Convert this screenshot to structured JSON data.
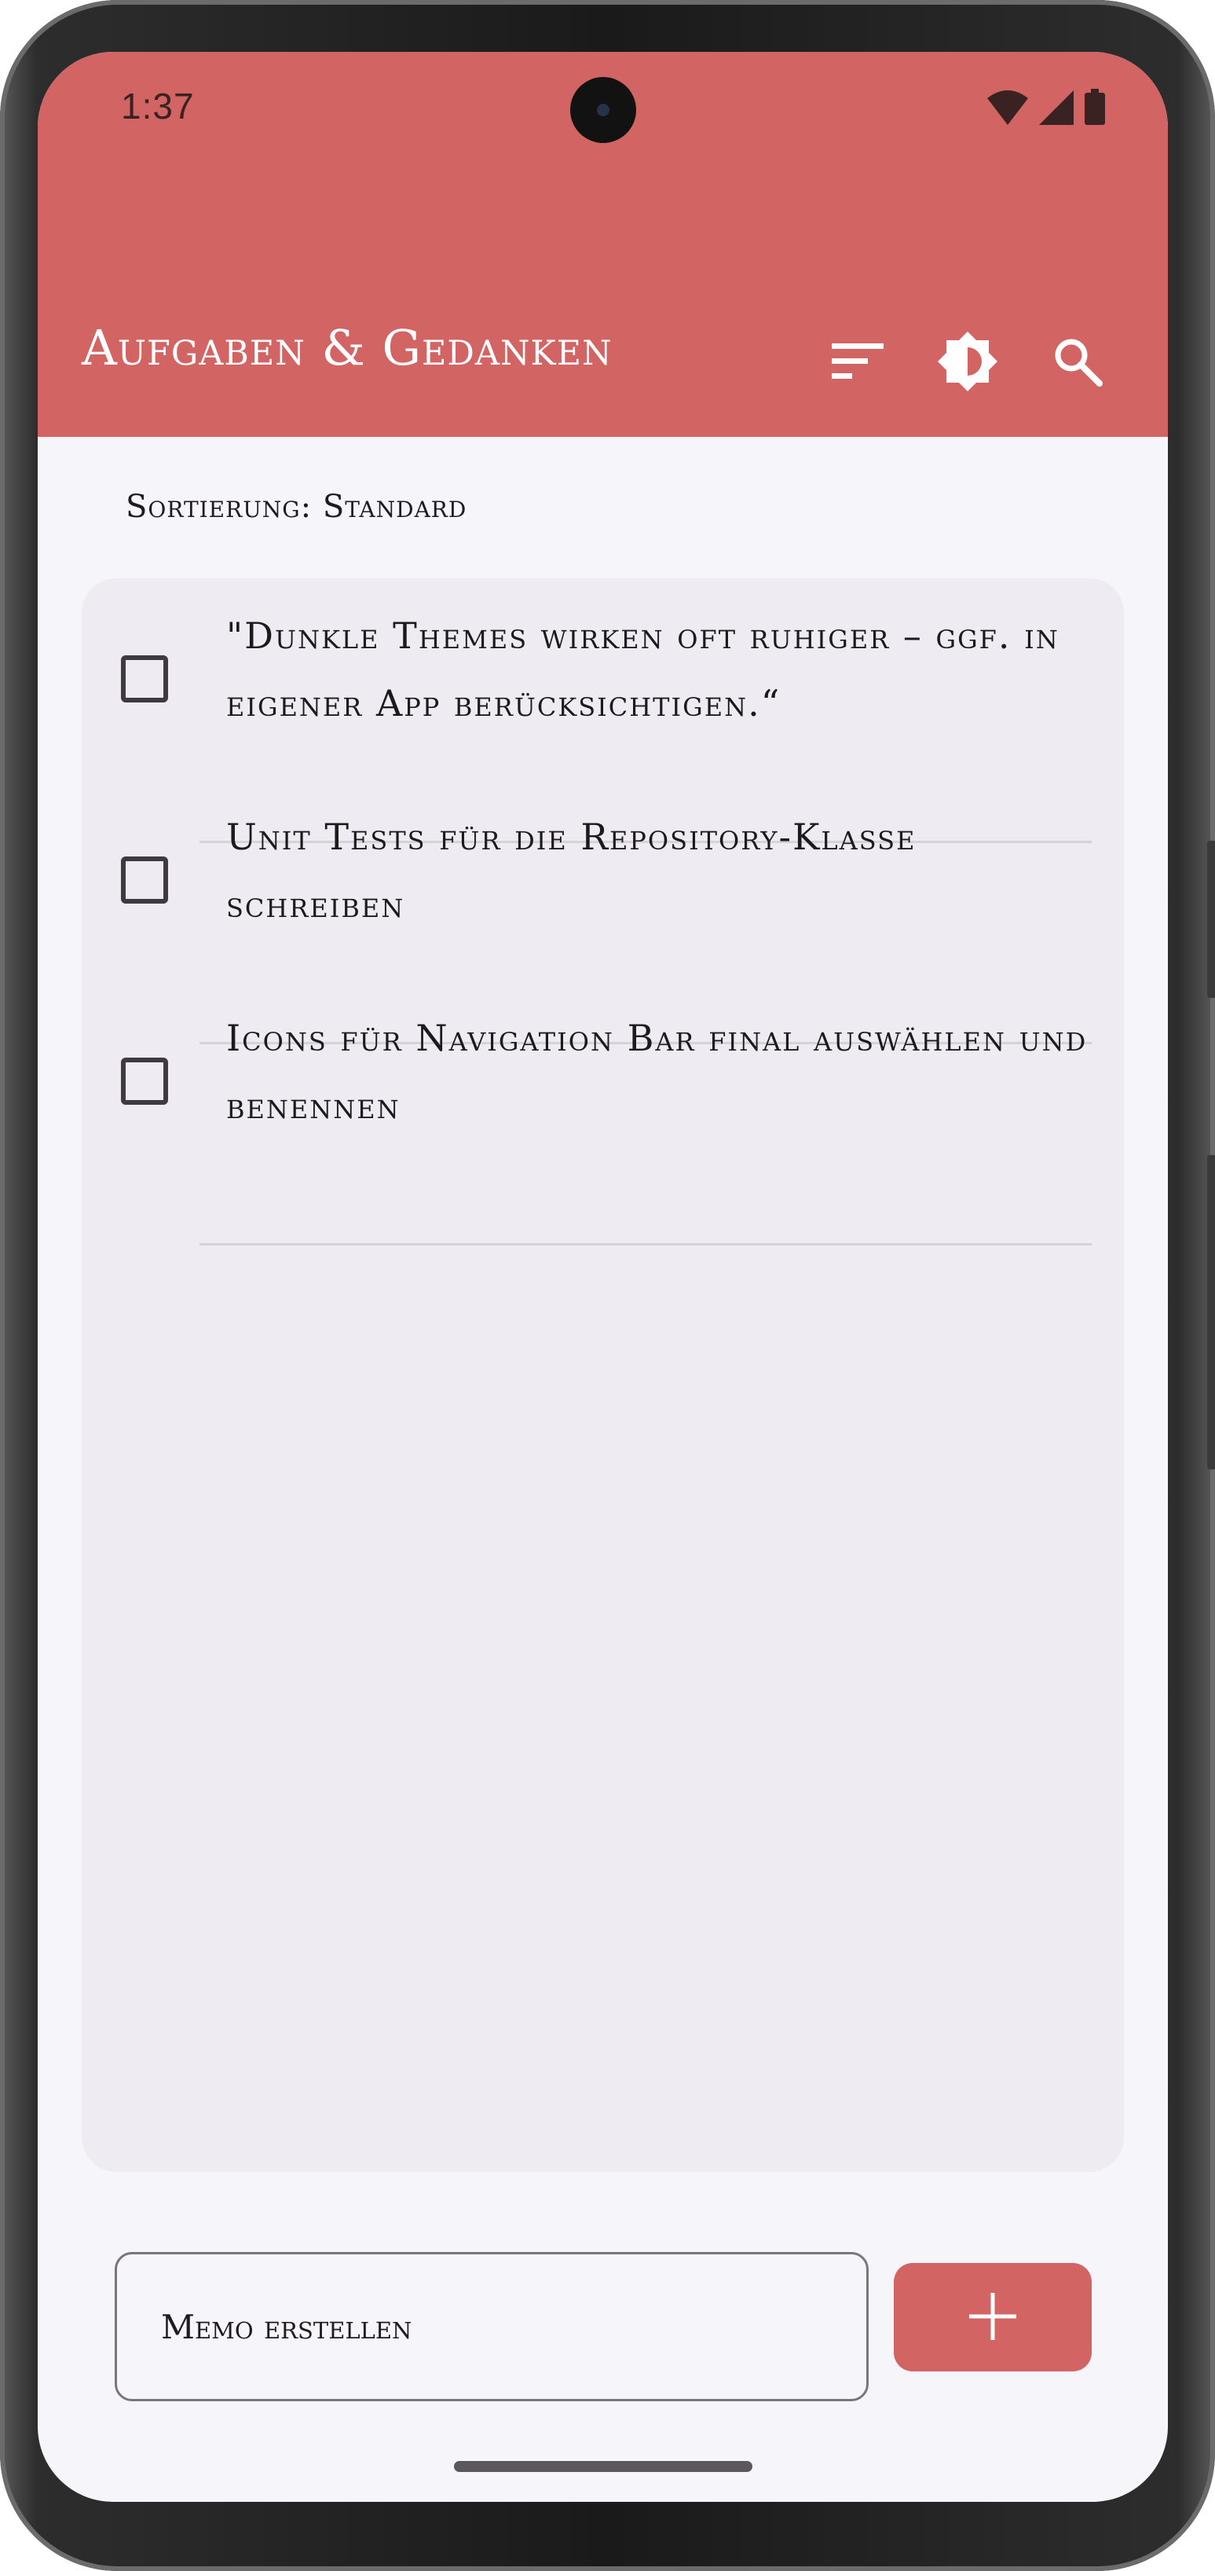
{
  "status_bar": {
    "time": "1:37",
    "icons": [
      "wifi-icon",
      "cellular-signal-icon",
      "battery-icon"
    ]
  },
  "app_bar": {
    "title": "Aufgaben & Gedanken",
    "background_color": "#d26564",
    "actions": [
      "sort-icon",
      "brightness-icon",
      "search-icon"
    ]
  },
  "sort": {
    "label": "Sortierung: Standard"
  },
  "memos": [
    {
      "text": "\"Dunkle Themes wirken oft ruhiger – ggf. in eigener App berücksichtigen.“",
      "checked": false
    },
    {
      "text": "Unit Tests für die Repository-Klasse schreiben",
      "checked": false
    },
    {
      "text": "Icons für Navigation Bar final auswählen und benennen",
      "checked": false
    }
  ],
  "input": {
    "placeholder": "Memo erstellen",
    "value": ""
  },
  "add_button": {
    "icon": "plus-icon",
    "color": "#d26564"
  }
}
